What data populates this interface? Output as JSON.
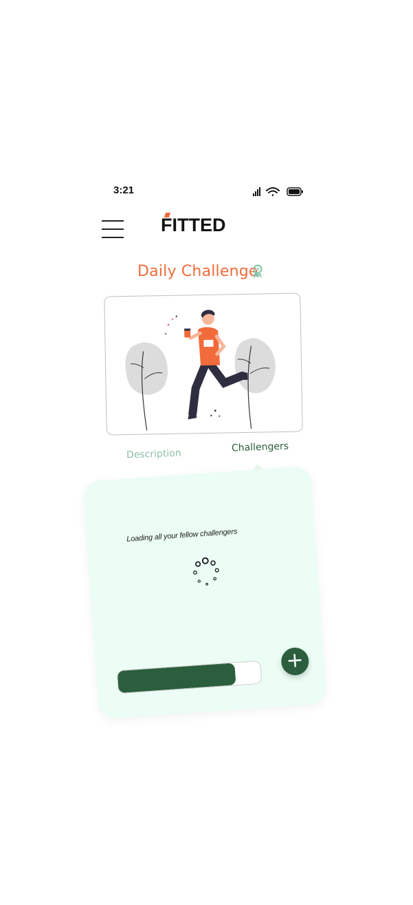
{
  "status_bar": {
    "time": "3:21",
    "icons": [
      "signal-icon",
      "wifi-icon",
      "battery-icon"
    ]
  },
  "header": {
    "logo": "FITTED",
    "menu_icon": "hamburger-menu-icon"
  },
  "page": {
    "title": "Daily Challenge",
    "title_icon": "award-ribbon-icon"
  },
  "illustration": {
    "icon": "runner-illustration"
  },
  "tabs": [
    {
      "label": "Description",
      "active": false
    },
    {
      "label": "Challengers",
      "active": true
    }
  ],
  "panel": {
    "loading_text": "Loading all your fellow challengers",
    "progress": 0.82,
    "fab_icon": "plus-icon",
    "fab_label": "+"
  },
  "colors": {
    "accent": "#f26b3a",
    "primary_dark_green": "#2b5e3d",
    "panel_bg": "#ebfdf4",
    "tab_inactive": "#8fbfa5"
  }
}
